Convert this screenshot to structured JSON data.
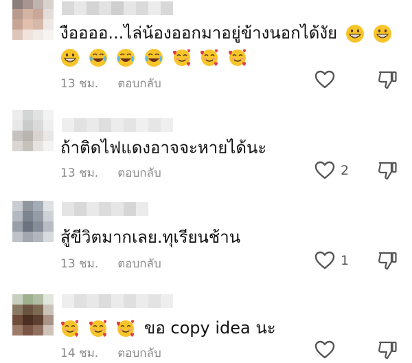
{
  "colors": {
    "meta_text": "#8a8a8a",
    "icon_stroke": "#555555",
    "emoji_yellow": "#f7c52a",
    "emoji_red": "#e63b44"
  },
  "comments": [
    {
      "text": "งืออออ...ไล่น้องออกมาอยู่ข้างนอกได้งัย",
      "emoji_after_text": [
        "grinning-face",
        "grinning-face"
      ],
      "emoji_line2": [
        "grinning-face",
        "joy-face",
        "joy-face",
        "joy-face",
        "smiling-face-with-hearts",
        "smiling-face-with-hearts",
        "smiling-face-with-hearts"
      ],
      "time": "13 ชม.",
      "reply": "ตอบกลับ",
      "likes": ""
    },
    {
      "text": "ถ้าติดไฟแดงอาจจะหายได้นะ",
      "time": "13 ชม.",
      "reply": "ตอบกลับ",
      "likes": "2"
    },
    {
      "text": "สู้ขีวิตมากเลย.ทุเรียนช้าน",
      "time": "13 ชม.",
      "reply": "ตอบกลับ",
      "likes": "1"
    },
    {
      "emoji_before_text": [
        "smiling-face-with-hearts",
        "smiling-face-with-hearts",
        "smiling-face-with-hearts"
      ],
      "text": "ขอ copy idea นะ",
      "time": "14 ชม.",
      "reply": "ตอบกลับ",
      "likes": ""
    }
  ]
}
